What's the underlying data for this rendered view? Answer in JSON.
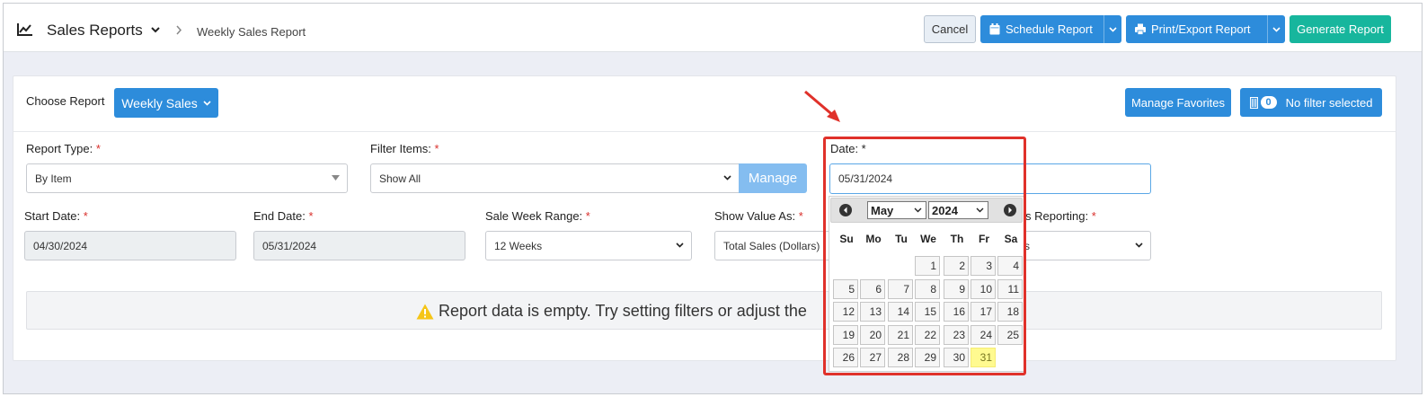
{
  "header": {
    "title": "Sales Reports",
    "breadcrumb": "Weekly Sales Report",
    "cancel": "Cancel",
    "schedule": "Schedule Report",
    "print": "Print/Export Report",
    "generate": "Generate Report"
  },
  "toolbar": {
    "choose_label": "Choose Report",
    "report_button": "Weekly Sales",
    "manage_favorites": "Manage Favorites",
    "filter_count": "0",
    "filter_status": "No filter selected"
  },
  "form": {
    "report_type": {
      "label": "Report Type:",
      "value": "By Item"
    },
    "filter_items": {
      "label": "Filter Items:",
      "value": "Show All",
      "manage": "Manage"
    },
    "date": {
      "label": "Date: *",
      "value": "05/31/2024"
    },
    "start_date": {
      "label": "Start Date:",
      "value": "04/30/2024"
    },
    "end_date": {
      "label": "End Date:",
      "value": "05/31/2024"
    },
    "sale_week_range": {
      "label": "Sale Week Range:",
      "value": "12 Weeks"
    },
    "show_value_as": {
      "label": "Show Value As:",
      "value": "Total Sales (Dollars)"
    },
    "reporting": {
      "label": "s Reporting:",
      "value": "s"
    },
    "required_mark": "*"
  },
  "empty_message": "Report data is empty. Try setting filters or adjust the",
  "calendar": {
    "month": "May",
    "year": "2024",
    "weekdays": [
      "Su",
      "Mo",
      "Tu",
      "We",
      "Th",
      "Fr",
      "Sa"
    ],
    "days": [
      "1",
      "2",
      "3",
      "4",
      "5",
      "6",
      "7",
      "8",
      "9",
      "10",
      "11",
      "12",
      "13",
      "14",
      "15",
      "16",
      "17",
      "18",
      "19",
      "20",
      "21",
      "22",
      "23",
      "24",
      "25",
      "26",
      "27",
      "28",
      "29",
      "30",
      "31"
    ],
    "first_weekday_index": 3,
    "selected_day": "31"
  },
  "colors": {
    "primary": "#2d8cdb",
    "success": "#17b69d",
    "annotation": "#e0312a",
    "today": "#fffa90"
  },
  "icons": [
    "chart-line-icon",
    "chevron-down-icon",
    "chevron-right-icon",
    "calendar-icon",
    "printer-icon",
    "filter-icon",
    "warning-icon",
    "prev-icon",
    "next-icon"
  ]
}
